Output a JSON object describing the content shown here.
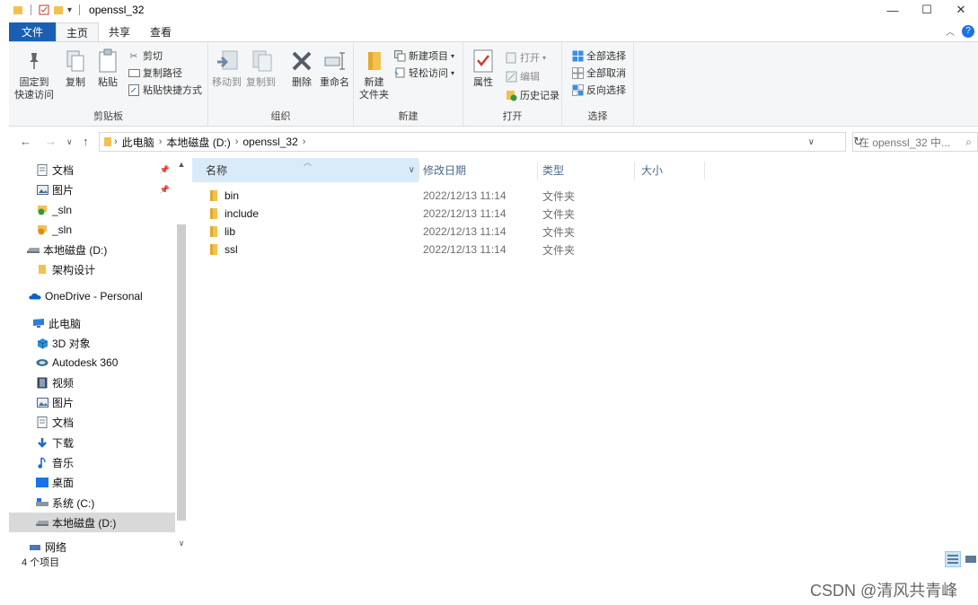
{
  "window": {
    "title": "openssl_32"
  },
  "ribbon_tabs": [
    "文件",
    "主页",
    "共享",
    "查看"
  ],
  "ribbon": {
    "clipboard": {
      "label": "剪贴板",
      "pin": "固定到\n快速访问",
      "copy": "复制",
      "paste": "粘贴",
      "cut": "剪切",
      "copy_path": "复制路径",
      "paste_shortcut": "粘贴快捷方式"
    },
    "organize": {
      "label": "组织",
      "move_to": "移动到",
      "copy_to": "复制到",
      "delete": "删除",
      "rename": "重命名"
    },
    "new": {
      "label": "新建",
      "new_folder": "新建\n文件夹",
      "new_item": "新建项目",
      "easy_access": "轻松访问"
    },
    "open": {
      "label": "打开",
      "properties": "属性",
      "open": "打开",
      "edit": "编辑",
      "history": "历史记录"
    },
    "select": {
      "label": "选择",
      "select_all": "全部选择",
      "select_none": "全部取消",
      "invert": "反向选择"
    }
  },
  "address": {
    "crumbs": [
      "此电脑",
      "本地磁盘 (D:)",
      "openssl_32"
    ],
    "search_placeholder": "在 openssl_32 中..."
  },
  "nav_pane": [
    {
      "label": "文档",
      "icon": "document-icon",
      "pinned": true
    },
    {
      "label": "图片",
      "icon": "pictures-icon",
      "pinned": true
    },
    {
      "label": "_sln",
      "icon": "sync-ok-icon"
    },
    {
      "label": "_sln",
      "icon": "sync-warn-icon"
    },
    {
      "label": "本地磁盘 (D:)",
      "icon": "drive-icon"
    },
    {
      "label": "架构设计",
      "icon": "folder-icon"
    },
    {
      "label": "OneDrive - Personal",
      "icon": "cloud-icon"
    },
    {
      "label": "此电脑",
      "icon": "pc-icon"
    },
    {
      "label": "3D 对象",
      "icon": "3d-objects-icon"
    },
    {
      "label": "Autodesk 360",
      "icon": "autodesk-icon"
    },
    {
      "label": "视频",
      "icon": "video-icon"
    },
    {
      "label": "图片",
      "icon": "pictures-icon"
    },
    {
      "label": "文档",
      "icon": "document-icon"
    },
    {
      "label": "下载",
      "icon": "download-icon"
    },
    {
      "label": "音乐",
      "icon": "music-icon"
    },
    {
      "label": "桌面",
      "icon": "desktop-icon"
    },
    {
      "label": "系统 (C:)",
      "icon": "system-drive-icon"
    },
    {
      "label": "本地磁盘 (D:)",
      "icon": "drive-icon",
      "selected": true
    },
    {
      "label": "网络",
      "icon": "network-icon"
    }
  ],
  "columns": [
    "名称",
    "修改日期",
    "类型",
    "大小"
  ],
  "files": [
    {
      "name": "bin",
      "date": "2022/12/13 11:14",
      "type": "文件夹"
    },
    {
      "name": "include",
      "date": "2022/12/13 11:14",
      "type": "文件夹"
    },
    {
      "name": "lib",
      "date": "2022/12/13 11:14",
      "type": "文件夹"
    },
    {
      "name": "ssl",
      "date": "2022/12/13 11:14",
      "type": "文件夹"
    }
  ],
  "status": {
    "count": "4 个项目"
  },
  "watermark": "CSDN @清风共青峰",
  "colors": {
    "accent": "#1a5fb4",
    "folder": "#f2c14e",
    "selected": "#d9d9d9"
  }
}
